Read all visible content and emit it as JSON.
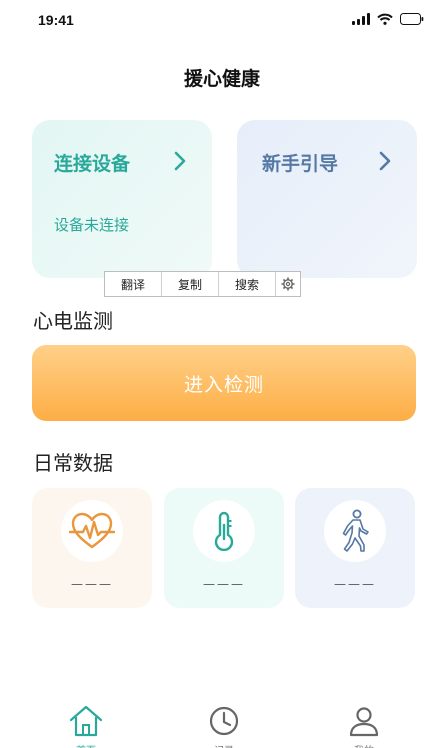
{
  "status_bar": {
    "time": "19:41"
  },
  "header": {
    "title": "援心健康"
  },
  "cards": {
    "connect": {
      "title": "连接设备",
      "status": "设备未连接"
    },
    "guide": {
      "title": "新手引导"
    }
  },
  "context_menu": {
    "items": [
      "翻译",
      "复制",
      "搜索"
    ]
  },
  "ecg": {
    "heading": "心电监测",
    "button": "进入检测"
  },
  "daily": {
    "heading": "日常数据",
    "metrics": [
      {
        "icon": "heart-rate-icon",
        "value": "———"
      },
      {
        "icon": "thermometer-icon",
        "value": "———"
      },
      {
        "icon": "walking-person-icon",
        "value": "———"
      }
    ]
  },
  "nav": {
    "home": "首页",
    "record": "记录",
    "mine": "我的"
  },
  "colors": {
    "teal": "#2aa99b",
    "blue": "#5579a5",
    "orange": "#fdae45",
    "heart": "#e8973c"
  }
}
